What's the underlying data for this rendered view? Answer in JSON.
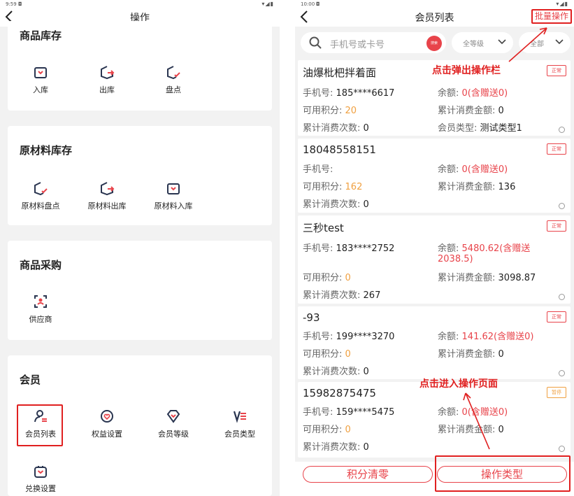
{
  "left": {
    "status": {
      "time": "9:59",
      "notif": "◘",
      "icons": "▾◢▮"
    },
    "title": "操作",
    "sections": [
      {
        "title": "商品库存",
        "items": [
          {
            "label": "入库",
            "icon": "inbox-in-icon"
          },
          {
            "label": "出库",
            "icon": "outbox-icon"
          },
          {
            "label": "盘点",
            "icon": "stocktake-icon"
          }
        ]
      },
      {
        "title": "原材料库存",
        "items": [
          {
            "label": "原材料盘点",
            "icon": "stocktake-icon"
          },
          {
            "label": "原材料出库",
            "icon": "outbox-icon"
          },
          {
            "label": "原材料入库",
            "icon": "inbox-in-icon"
          }
        ]
      },
      {
        "title": "商品采购",
        "items": [
          {
            "label": "供应商",
            "icon": "supplier-icon"
          }
        ]
      },
      {
        "title": "会员",
        "items": [
          {
            "label": "会员列表",
            "icon": "member-list-icon"
          },
          {
            "label": "权益设置",
            "icon": "benefits-icon"
          },
          {
            "label": "会员等级",
            "icon": "diamond-icon"
          },
          {
            "label": "会员类型",
            "icon": "member-type-icon"
          },
          {
            "label": "兑换设置",
            "icon": "gift-bag-icon"
          }
        ]
      }
    ]
  },
  "right": {
    "status": {
      "time": "10:00",
      "notif": "◘",
      "icons": "▾◢▮"
    },
    "title": "会员列表",
    "batch_label": "批量操作",
    "search": {
      "placeholder": "手机号或卡号",
      "button": "搜索"
    },
    "filters": [
      {
        "label": "全等级"
      },
      {
        "label": "全部"
      }
    ],
    "labels": {
      "phone": "手机号:",
      "balance": "余额:",
      "points": "可用积分:",
      "total_amount": "累计消费金额:",
      "total_count": "累计消费次数:",
      "member_type": "会员类型:"
    },
    "members": [
      {
        "name": "油爆枇杷拌着面",
        "status": "正常",
        "phone": "185****6617",
        "balance": "0(含赠送0)",
        "points": "20",
        "total_amount": "0",
        "total_count": "0",
        "member_type": "测试类型1"
      },
      {
        "name": "18048558151",
        "status": "正常",
        "phone": "",
        "balance": "0(含赠送0)",
        "points": "162",
        "total_amount": "136",
        "total_count": "0"
      },
      {
        "name": "三秒test",
        "status": "正常",
        "phone": "183****2752",
        "balance_line1": "5480.62(含赠送",
        "balance_line2": "2038.5)",
        "points": "0",
        "total_amount": "3098.87",
        "total_count": "267"
      },
      {
        "name": "-93",
        "status": "正常",
        "phone": "199****3270",
        "balance": "141.62(含赠送0)",
        "points": "0",
        "total_amount": "0",
        "total_count": "0"
      },
      {
        "name": "15982875475",
        "status": "暂停",
        "phone": "159****5475",
        "balance": "0(含赠送0)",
        "points": "0",
        "total_amount": "0",
        "total_count": "0"
      }
    ],
    "bottom": {
      "clear_points": "积分清零",
      "operation_type": "操作类型"
    },
    "annotations": {
      "popup_bar": "点击弹出操作栏",
      "enter_page": "点击进入操作页面"
    }
  },
  "colors": {
    "accent": "#e8434a",
    "annotation": "#e02020",
    "points": "#f0a040",
    "background": "#f2f2f2"
  }
}
